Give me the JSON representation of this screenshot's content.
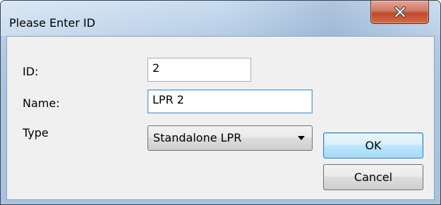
{
  "window": {
    "title": "Please Enter ID"
  },
  "form": {
    "id_label": "ID:",
    "id_value": "2",
    "name_label": "Name:",
    "name_value": "LPR 2",
    "type_label": "Type",
    "type_selected": "Standalone LPR"
  },
  "buttons": {
    "ok_label": "OK",
    "cancel_label": "Cancel"
  },
  "icons": {
    "close": "close-icon",
    "dropdown": "chevron-down-icon"
  },
  "colors": {
    "close_button": "#c9553a",
    "default_button_border": "#3c7fb1",
    "focused_border": "#5b9bd5"
  }
}
